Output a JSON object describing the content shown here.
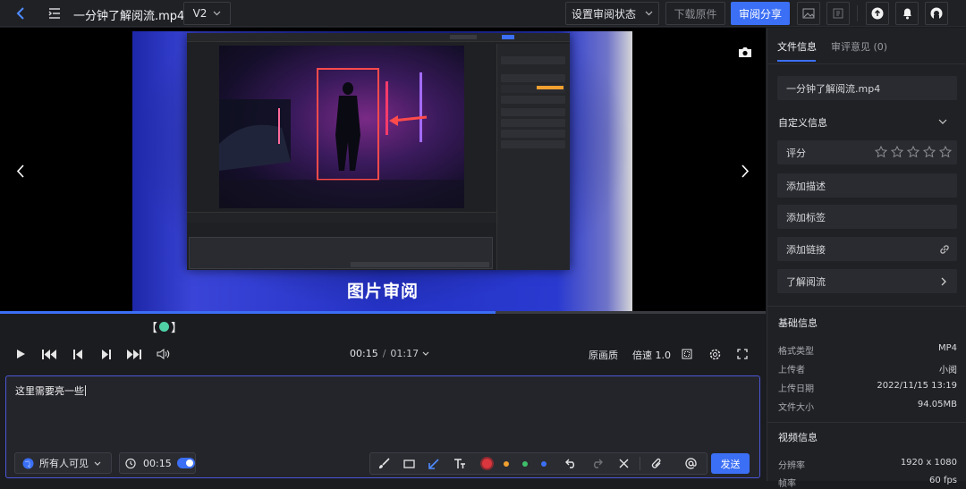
{
  "header": {
    "title": "一分钟了解阅流.mp4",
    "version": "V2",
    "status_button": "设置审阅状态",
    "download_button": "下载原件",
    "share_button": "审阅分享"
  },
  "player": {
    "caption": "图片审阅",
    "progress_fraction": 0.647,
    "current_time": "00:15",
    "time_separator": "/",
    "total_time": "01:17",
    "quality_label": "原画质",
    "speed_label": "倍速 1.0",
    "marker_left": "【",
    "marker_right": "】"
  },
  "comment": {
    "text": "这里需要亮一些",
    "visibility": "所有人可见",
    "timestamp": "00:15",
    "send_label": "发送",
    "colors": [
      "#d9363e",
      "#f0a030",
      "#3fbf6a",
      "#3b6ff5"
    ]
  },
  "sidebar": {
    "tabs": {
      "info": "文件信息",
      "comments": "审评意见 (0)"
    },
    "file_name": "一分钟了解阅流.mp4",
    "custom_info_title": "自定义信息",
    "rating_label": "评分",
    "rating_value": 0,
    "add_desc": "添加描述",
    "add_tag": "添加标签",
    "add_link": "添加链接",
    "learn_more": "了解阅流",
    "basic_title": "基础信息",
    "basic": [
      {
        "k": "格式类型",
        "v": "MP4"
      },
      {
        "k": "上传者",
        "v": "小阅"
      },
      {
        "k": "上传日期",
        "v": "2022/11/15 13:19"
      },
      {
        "k": "文件大小",
        "v": "94.05MB"
      }
    ],
    "video_title": "视频信息",
    "video": [
      {
        "k": "分辨率",
        "v": "1920 x 1080"
      },
      {
        "k": "帧率",
        "v": "60 fps"
      }
    ]
  }
}
